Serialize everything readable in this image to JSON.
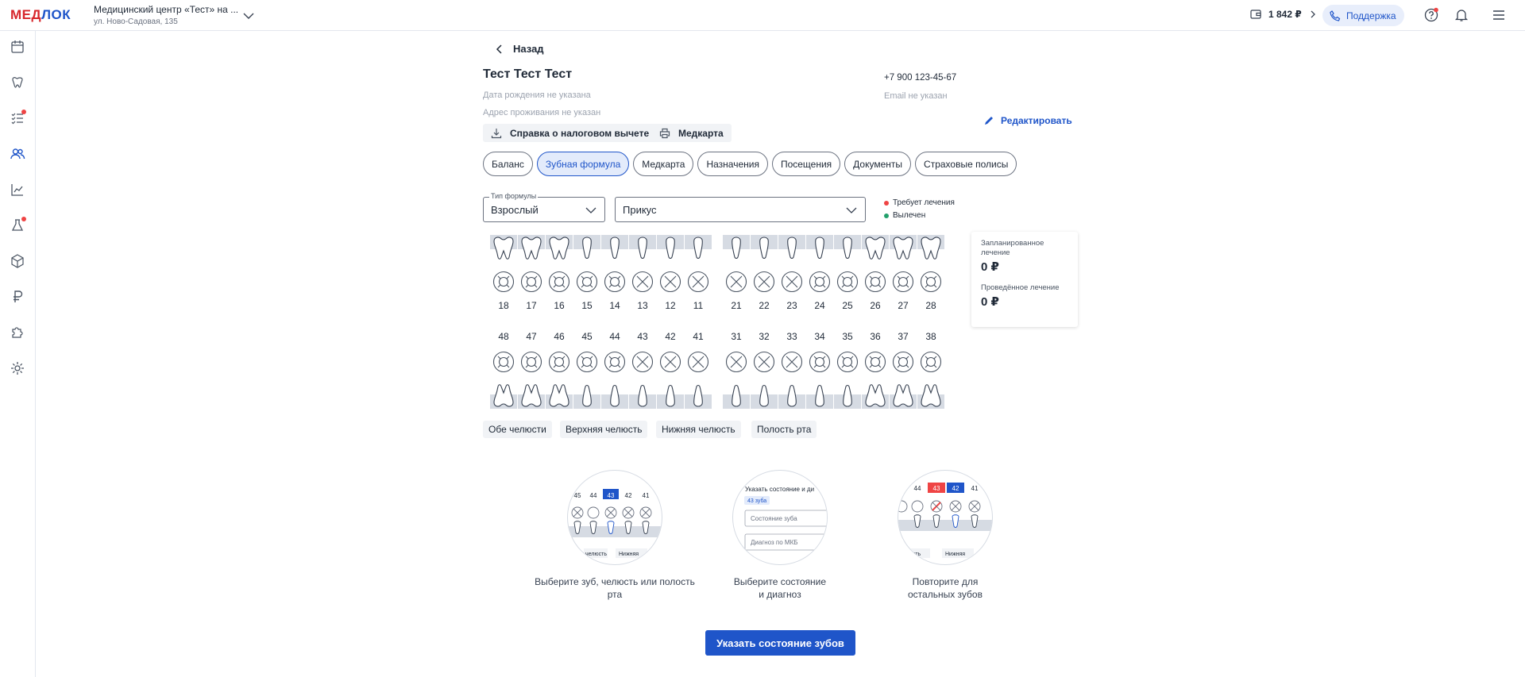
{
  "header": {
    "logo_part1": "МЕД",
    "logo_part2": "ЛОК",
    "clinic_name": "Медицинский центр «Тест» на ...",
    "clinic_address": "ул. Ново-Садовая, 135",
    "balance": "1 842 ₽",
    "support_label": "Поддержка"
  },
  "patient": {
    "back_label": "Назад",
    "name": "Тест Тест Тест",
    "birth_date": "Дата рождения не указана",
    "address": "Адрес проживания не указан",
    "phone": "+7 900 123-45-67",
    "email": "Email не указан",
    "edit_label": "Редактировать",
    "tax_button": "Справка о налоговом вычете",
    "medcard_button": "Медкарта"
  },
  "tabs": [
    {
      "label": "Баланс",
      "active": false
    },
    {
      "label": "Зубная формула",
      "active": true
    },
    {
      "label": "Медкарта",
      "active": false
    },
    {
      "label": "Назначения",
      "active": false
    },
    {
      "label": "Посещения",
      "active": false
    },
    {
      "label": "Документы",
      "active": false
    },
    {
      "label": "Страховые полисы",
      "active": false
    }
  ],
  "formula": {
    "type_label": "Тип формулы",
    "type_value": "Взрослый",
    "bite_value": "Прикус",
    "legend": [
      {
        "label": "Требует лечения",
        "color": "#ef4444"
      },
      {
        "label": "Вылечен",
        "color": "#22a06b"
      }
    ],
    "upper_teeth": [
      "18",
      "17",
      "16",
      "15",
      "14",
      "13",
      "12",
      "11",
      "21",
      "22",
      "23",
      "24",
      "25",
      "26",
      "27",
      "28"
    ],
    "lower_teeth": [
      "48",
      "47",
      "46",
      "45",
      "44",
      "43",
      "42",
      "41",
      "31",
      "32",
      "33",
      "34",
      "35",
      "36",
      "37",
      "38"
    ]
  },
  "summary": {
    "planned_label": "Запланированное лечение",
    "planned_value": "0 ₽",
    "done_label": "Проведённое лечение",
    "done_value": "0 ₽"
  },
  "jaw_buttons": [
    "Обе челюсти",
    "Верхняя челюсть",
    "Нижняя челюсть",
    "Полость рта"
  ],
  "steps": {
    "step1": {
      "text": "Выберите зуб, челюсть или полость рта",
      "numbers": [
        "45",
        "44",
        "43",
        "42",
        "41"
      ],
      "bottom_left": "челюсть",
      "bottom_right": "Нижняя"
    },
    "step2": {
      "text": "Выберите состояние и диагноз",
      "title": "Указать состояние и ди",
      "chip": "43 зуба",
      "field1": "Состояние зуба",
      "field2": "Диагноз по МКБ"
    },
    "step3": {
      "text": "Повторите для остальных зубов",
      "numbers": [
        "44",
        "43",
        "42",
        "41"
      ],
      "bottom_left": "есть",
      "bottom_right": "Нижняя"
    }
  },
  "cta_label": "Указать состояние зубов",
  "colors": {
    "accent": "#1f55c9",
    "brand_red": "#d7262b"
  }
}
